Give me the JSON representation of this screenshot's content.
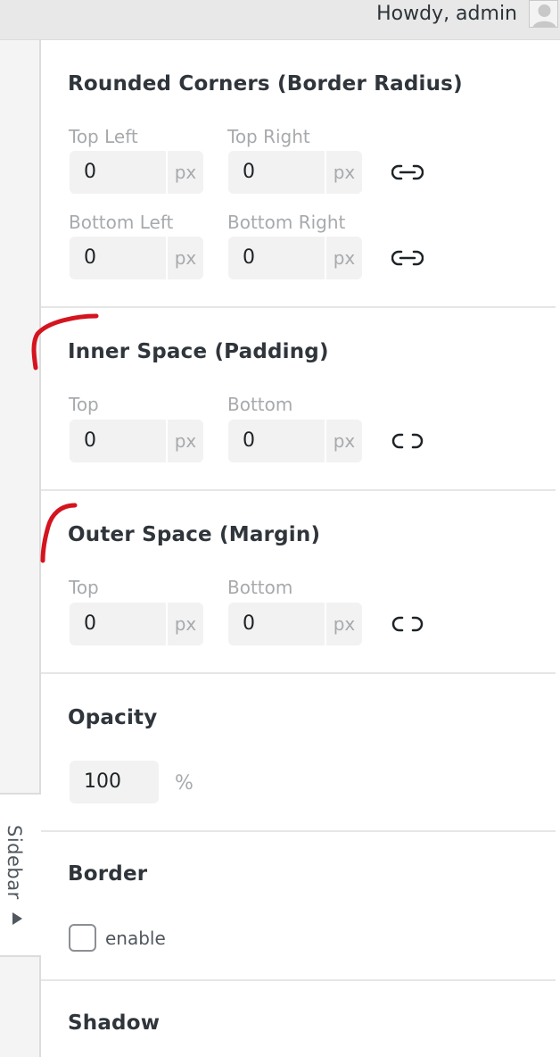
{
  "adminbar": {
    "greeting": "Howdy, admin"
  },
  "sidebar_tab": {
    "label": "Sidebar"
  },
  "border_radius": {
    "title": "Rounded Corners (Border Radius)",
    "fields": [
      {
        "label": "Top Left",
        "value": "0",
        "unit": "px"
      },
      {
        "label": "Top Right",
        "value": "0",
        "unit": "px"
      },
      {
        "label": "Bottom Left",
        "value": "0",
        "unit": "px"
      },
      {
        "label": "Bottom Right",
        "value": "0",
        "unit": "px"
      }
    ],
    "link_icons": [
      "linked-icon",
      "linked-icon"
    ]
  },
  "padding": {
    "title": "Inner Space (Padding)",
    "fields": [
      {
        "label": "Top",
        "value": "0",
        "unit": "px"
      },
      {
        "label": "Bottom",
        "value": "0",
        "unit": "px"
      }
    ],
    "link_icon": "unlinked-icon"
  },
  "margin": {
    "title": "Outer Space (Margin)",
    "fields": [
      {
        "label": "Top",
        "value": "0",
        "unit": "px"
      },
      {
        "label": "Bottom",
        "value": "0",
        "unit": "px"
      }
    ],
    "link_icon": "unlinked-icon"
  },
  "opacity": {
    "title": "Opacity",
    "value": "100",
    "unit": "%"
  },
  "border": {
    "title": "Border",
    "checkbox_label": "enable",
    "checked": false
  },
  "shadow": {
    "title": "Shadow"
  },
  "colors": {
    "annotation": "#d4141f",
    "panel_bg": "#ffffff",
    "input_bg": "#f2f2f2"
  }
}
